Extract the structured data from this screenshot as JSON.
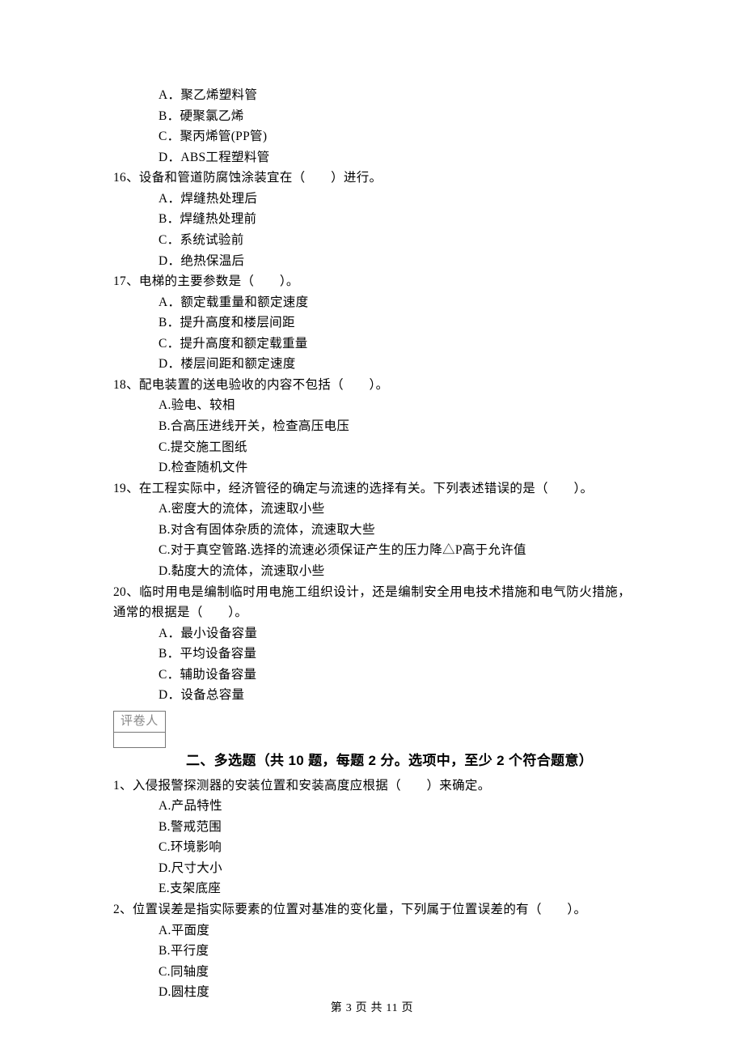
{
  "prev_q_opts": [
    "A．聚乙烯塑料管",
    "B．硬聚氯乙烯",
    "C．聚丙烯管(PP管)",
    "D．ABS工程塑料管"
  ],
  "q16": {
    "stem": "16、设备和管道防腐蚀涂装宜在（　　）进行。",
    "opts": [
      "A．焊缝热处理后",
      "B．焊缝热处理前",
      "C．系统试验前",
      "D．绝热保温后"
    ]
  },
  "q17": {
    "stem": "17、电梯的主要参数是（　　）。",
    "opts": [
      "A．额定载重量和额定速度",
      "B．提升高度和楼层间距",
      "C．提升高度和额定载重量",
      "D．楼层间距和额定速度"
    ]
  },
  "q18": {
    "stem": "18、配电装置的送电验收的内容不包括（　　）。",
    "opts": [
      "A.验电、较相",
      "B.合高压进线开关，检查高压电压",
      "C.提交施工图纸",
      "D.检查随机文件"
    ]
  },
  "q19": {
    "stem": "19、在工程实际中，经济管径的确定与流速的选择有关。下列表述错误的是（　　）。",
    "opts": [
      "A.密度大的流体，流速取小些",
      "B.对含有固体杂质的流体，流速取大些",
      "C.对于真空管路.选择的流速必须保证产生的压力降△P高于允许值",
      "D.黏度大的流体，流速取小些"
    ]
  },
  "q20": {
    "stem": "20、临时用电是编制临时用电施工组织设计，还是编制安全用电技术措施和电气防火措施，通常的根据是（　　）。",
    "opts": [
      "A．最小设备容量",
      "B．平均设备容量",
      "C．辅助设备容量",
      "D．设备总容量"
    ]
  },
  "grader_label": "评卷人",
  "section2_title": "二、多选题（共 10 题，每题 2 分。选项中，至少 2 个符合题意）",
  "mq1": {
    "stem": "1、入侵报警探测器的安装位置和安装高度应根据（　　）来确定。",
    "opts": [
      "A.产品特性",
      "B.警戒范围",
      "C.环境影响",
      "D.尺寸大小",
      "E.支架底座"
    ]
  },
  "mq2": {
    "stem": "2、位置误差是指实际要素的位置对基准的变化量，下列属于位置误差的有（　　）。",
    "opts": [
      "A.平面度",
      "B.平行度",
      "C.同轴度",
      "D.圆柱度"
    ]
  },
  "footer": "第 3 页 共 11 页"
}
